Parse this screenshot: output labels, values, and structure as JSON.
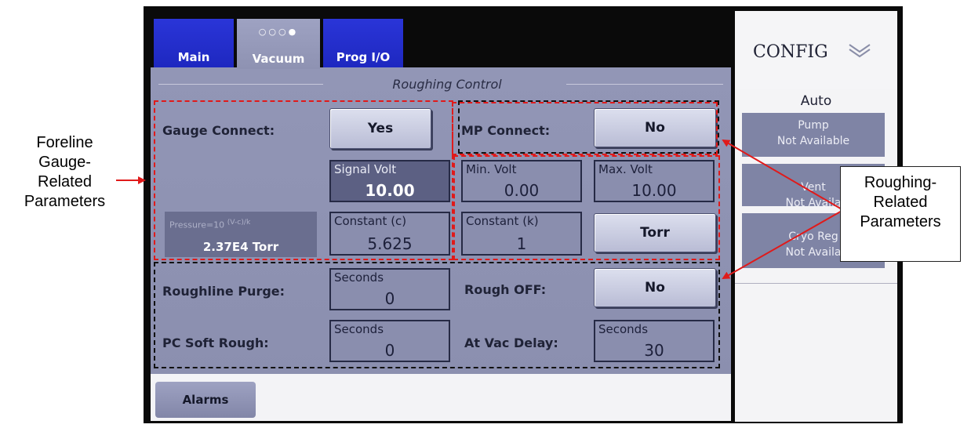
{
  "tabs": [
    {
      "label": "Main"
    },
    {
      "label": "Vacuum",
      "indicator": "○○○●"
    },
    {
      "label": "Prog I/O"
    }
  ],
  "section_title": "Roughing Control",
  "gauge_connect": {
    "label": "Gauge Connect:",
    "value": "Yes"
  },
  "mp_connect": {
    "label": "MP Connect:",
    "value": "No"
  },
  "signal_volt": {
    "caption": "Signal Volt",
    "value": "10.00"
  },
  "min_volt": {
    "caption": "Min. Volt",
    "value": "0.00"
  },
  "max_volt": {
    "caption": "Max. Volt",
    "value": "10.00"
  },
  "pressure": {
    "formula": "Pressure=10",
    "exponent": "(V-c)/k",
    "value": "2.37E4 Torr"
  },
  "constant_c": {
    "caption": "Constant (c)",
    "value": "5.625"
  },
  "constant_k": {
    "caption": "Constant (k)",
    "value": "1"
  },
  "units_button": "Torr",
  "roughline_purge": {
    "label": "Roughline Purge:",
    "caption": "Seconds",
    "value": "0"
  },
  "rough_off": {
    "label": "Rough OFF:",
    "value": "No"
  },
  "pc_soft_rough": {
    "label": "PC Soft Rough:",
    "caption": "Seconds",
    "value": "0"
  },
  "at_vac_delay": {
    "label": "At Vac Delay:",
    "caption": "Seconds",
    "value": "30"
  },
  "alarms_tab": "Alarms",
  "config": {
    "title": "CONFIG",
    "mode": "Auto",
    "buttons": [
      {
        "line1": "Pump",
        "line2": "Not Available"
      },
      {
        "line1": "Vent",
        "line2": "Not Availa"
      },
      {
        "line1": "Cryo Reg",
        "line2": "Not Availa"
      }
    ]
  },
  "annotations": {
    "foreline": [
      "Foreline",
      "Gauge-",
      "Related",
      "Parameters"
    ],
    "roughing": [
      "Roughing-",
      "Related",
      "Parameters"
    ]
  },
  "colors": {
    "annotation_red": "#e01a1a",
    "tab_blue": "#2a35d8"
  }
}
